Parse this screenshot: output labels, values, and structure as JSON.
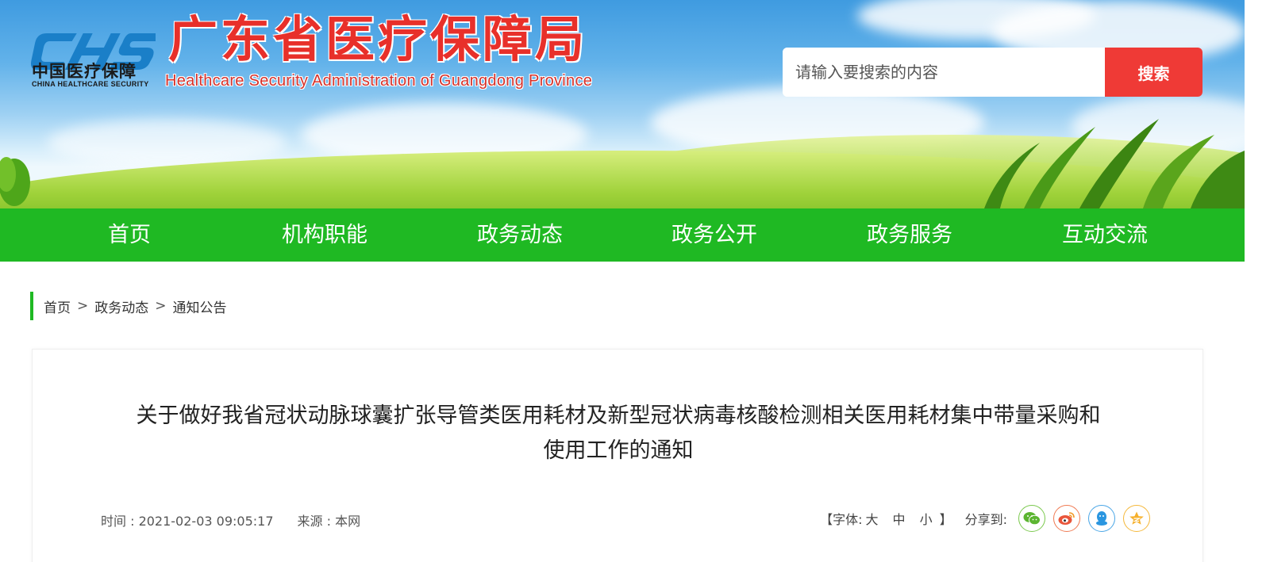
{
  "header": {
    "logo_cn": "中国医疗保障",
    "logo_en": "CHINA HEALTHCARE SECURITY",
    "site_title_cn": "广东省医疗保障局",
    "site_title_en": "Healthcare Security Administration of Guangdong Province"
  },
  "search": {
    "placeholder": "请输入要搜索的内容",
    "button_label": "搜索"
  },
  "nav": {
    "items": [
      {
        "label": "首页"
      },
      {
        "label": "机构职能"
      },
      {
        "label": "政务动态"
      },
      {
        "label": "政务公开"
      },
      {
        "label": "政务服务"
      },
      {
        "label": "互动交流"
      }
    ]
  },
  "breadcrumb": {
    "items": [
      "首页",
      "政务动态",
      "通知公告"
    ],
    "separator": ">"
  },
  "article": {
    "title_line1": "关于做好我省冠状动脉球囊扩张导管类医用耗材及新型冠状病毒核酸检测相关医用耗材集中带量采购和",
    "title_line2": "使用工作的通知",
    "time_label": "时间 : 2021-02-03 09:05:17",
    "source_label": "来源 : 本网"
  },
  "tools": {
    "font_open": "【字体:",
    "font_large": "大",
    "font_medium": "中",
    "font_small": "小",
    "font_close": "】",
    "share_label": "分享到:",
    "share_icons": [
      "wechat-icon",
      "weibo-icon",
      "qq-icon",
      "qzone-icon"
    ]
  },
  "colors": {
    "nav_green": "#1fb923",
    "search_red": "#ef3a36",
    "title_red": "#e8302a",
    "logo_blue": "#1a7fc8"
  }
}
